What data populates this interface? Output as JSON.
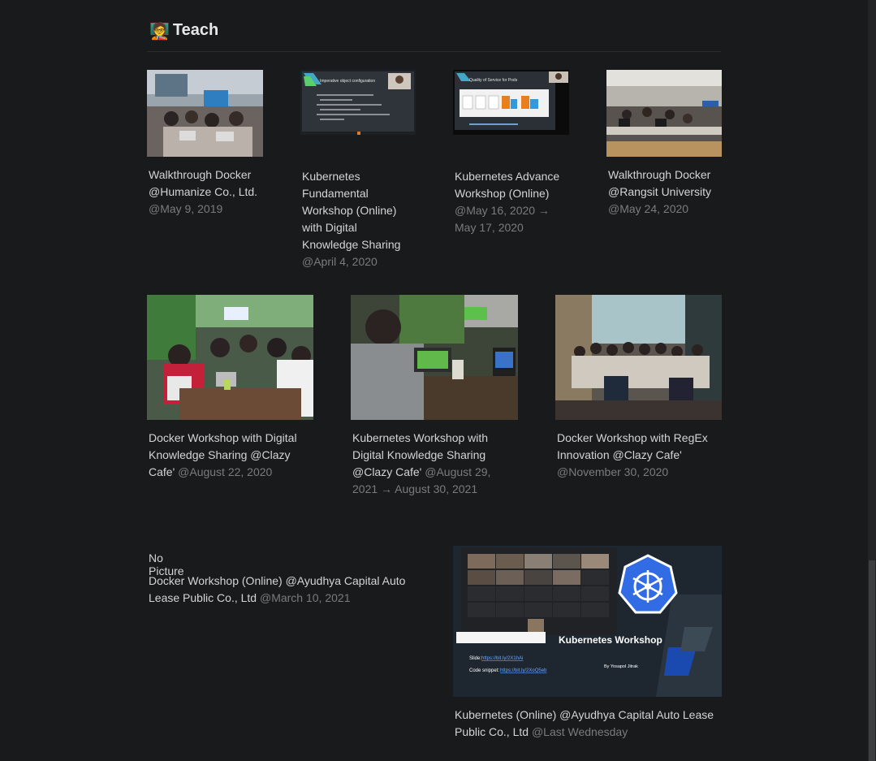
{
  "section": {
    "emoji": "🧑‍🏫",
    "title": "Teach"
  },
  "cards": [
    {
      "title": "Walkthrough Docker @Humanize Co., Ltd.",
      "date": "@May 9, 2019"
    },
    {
      "title": "Kubernetes Fundamental Workshop (Online) with Digital Knowledge Sharing",
      "date": "@April 4, 2020",
      "slide_heading": "Imperative object configuration"
    },
    {
      "title": "Kubernetes Advance Workshop (Online)",
      "date": "@May 16, 2020 → May 17, 2020",
      "slide_heading": "Quality of Service for Pods"
    },
    {
      "title": "Walkthrough Docker @Rangsit University",
      "date": "@May 24, 2020"
    },
    {
      "title": "Docker Workshop with Digital Knowledge Sharing  @Clazy Cafe'",
      "date": "@August 22, 2020"
    },
    {
      "title": "Kubernetes Workshop with Digital Knowledge Sharing @Clazy Cafe'",
      "date": "@August 29, 2021 → August 30, 2021"
    },
    {
      "title": "Docker Workshop with RegEx Innovation @Clazy Cafe'",
      "date": "@November 30, 2020"
    },
    {
      "title": "Docker Workshop (Online) @Ayudhya Capital Auto Lease Public Co., Ltd",
      "date": "@March 10, 2021",
      "no_picture": "No Picture"
    },
    {
      "title": "Kubernetes (Online) @Ayudhya Capital Auto Lease Public Co., Ltd",
      "date": "@Last Wednesday",
      "slide": {
        "heading": "Kubernetes Workshop",
        "slide_label": "Slide:",
        "slide_link": "https://bit.ly/2X1hAi",
        "code_label": "Code snippet:",
        "code_link": "https://bit.ly/2XoQ5eb",
        "author": "By Yosapol Jitrak"
      }
    }
  ],
  "colors": {
    "background": "#191a1c",
    "text": "#d4d4d4",
    "muted": "#7b7b7b",
    "kube_blue": "#326ce5"
  }
}
